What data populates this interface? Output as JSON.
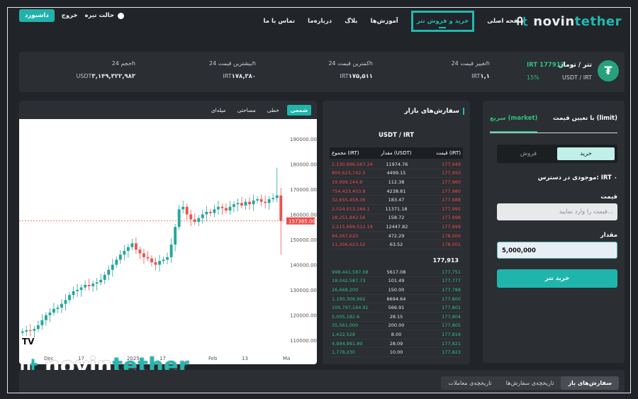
{
  "brand": {
    "name_prefix": "novin",
    "name_suffix": "tether"
  },
  "nav": {
    "items": [
      {
        "label": "صفحه اصلی"
      },
      {
        "label": "خرید و فروش تتر"
      },
      {
        "label": "آموزش‌ها"
      },
      {
        "label": "بلاگ"
      },
      {
        "label": "درباره‌ما"
      },
      {
        "label": "تماس با ما"
      }
    ],
    "dark_mode_label": "حالت تیره",
    "logout_label": "خروج",
    "dashboard_label": "داشبورد"
  },
  "summary": {
    "coin_name": "تتر / تومان",
    "pair": "USDT / IRT",
    "price": "IRT 177913",
    "change": "15%",
    "stats": [
      {
        "label": "تغییر قیمت 24h",
        "value": "۱,۱",
        "unit": "IRT"
      },
      {
        "label": "کمترین قیمت 24h",
        "value": "۱۷۵,۵۱۱",
        "unit": "IRT"
      },
      {
        "label": "بیشترین قیمت 24h",
        "value": "۱۷۸,۳۸۰",
        "unit": "IRT"
      },
      {
        "label": "حجم 24h",
        "value": "۳,۱۴۹,۳۲۲,۹۸۳",
        "unit": "USDT"
      }
    ]
  },
  "trade": {
    "tab_limit": "با تعیین قیمت (limit)",
    "tab_market": "سریع (market)",
    "buy_label": "خرید",
    "sell_label": "فروش",
    "available": "موجودی در دسترس: IRT ۰",
    "price_label": "قیمت",
    "price_placeholder": "قیمت را وارد نمایید...",
    "amount_label": "مقدار",
    "amount_value": "5,000,000",
    "submit_label": "خرید تتر"
  },
  "orderbook": {
    "title": "سفارش‌های بازار",
    "pair": "USDT / IRT",
    "headers": [
      "قیمت (IRT)",
      "مقدار (USDT)",
      "مجموع (IRT)"
    ],
    "mid_price": "177,913",
    "asks": [
      [
        "177,949",
        "11974.76",
        "2,130,896,567.24"
      ],
      [
        "177,950",
        "4499.15",
        "800,623,742.5"
      ],
      [
        "177,960",
        "112.38",
        "19,999,144.8"
      ],
      [
        "177,980",
        "4238.81",
        "754,423,403.8"
      ],
      [
        "177,988",
        "183.47",
        "32,655,458.36"
      ],
      [
        "177,995",
        "11371.18",
        "2,024,013,184.1"
      ],
      [
        "177,998",
        "158.72",
        "28,251,842.56"
      ],
      [
        "177,999",
        "12447.82",
        "2,215,699,512.18"
      ],
      [
        "178,000",
        "472.29",
        "84,067,620"
      ],
      [
        "178,001",
        "63.52",
        "11,306,623.52"
      ]
    ],
    "bids": [
      [
        "177,751",
        "5617.08",
        "998,441,587.08"
      ],
      [
        "177,777",
        "101.49",
        "18,042,587.73"
      ],
      [
        "177,788",
        "150.00",
        "26,668,200"
      ],
      [
        "177,800",
        "6694.64",
        "1,190,306,992"
      ],
      [
        "177,801",
        "566.91",
        "100,797,164.91"
      ],
      [
        "177,804",
        "28.15",
        "5,005,182.6"
      ],
      [
        "177,805",
        "200.00",
        "35,561,000"
      ],
      [
        "177,816",
        "8.00",
        "1,422,528"
      ],
      [
        "177,821",
        "28.09",
        "4,994,991.89"
      ],
      [
        "177,823",
        "10.00",
        "1,778,230"
      ]
    ]
  },
  "chart": {
    "tabs": [
      "شمعی",
      "خطی",
      "مساحتی",
      "میله‌ای"
    ],
    "last_price_label": "157385.00"
  },
  "chart_data": {
    "type": "candlestick",
    "y_ticks": [
      "190000.00",
      "180000.00",
      "170000.00",
      "160000.00",
      "150000.00",
      "140000.00",
      "130000.00",
      "120000.00",
      "110000.00"
    ],
    "x_ticks": [
      "Dec",
      "17",
      "2025",
      "17",
      "Feb",
      "13",
      "Ma"
    ],
    "ylim": [
      105000,
      195000
    ],
    "last_price": 157385,
    "series_close": [
      113500,
      114000,
      113800,
      114500,
      116000,
      118000,
      120000,
      121000,
      122500,
      123000,
      124500,
      126000,
      128000,
      129500,
      130000,
      131000,
      132000,
      131500,
      132500,
      133000,
      134000,
      136000,
      138000,
      140000,
      142000,
      144000,
      145500,
      147000,
      148500,
      146000,
      144500,
      143000,
      142500,
      141000,
      140000,
      141500,
      142000,
      143000,
      148000,
      155000,
      162000,
      163000,
      160000,
      158000,
      157000,
      158500,
      160000,
      161000,
      160500,
      162000,
      163000,
      162500,
      161500,
      163000,
      164000,
      164500,
      163500,
      165000,
      164000,
      165500,
      166000,
      165000,
      164500,
      166000,
      166500,
      167500,
      157385
    ]
  },
  "bottom_tabs": [
    "سفارش‌های باز",
    "تاریخچه‌ی سفارش‌ها",
    "تاریخچه‌ی معاملات"
  ]
}
